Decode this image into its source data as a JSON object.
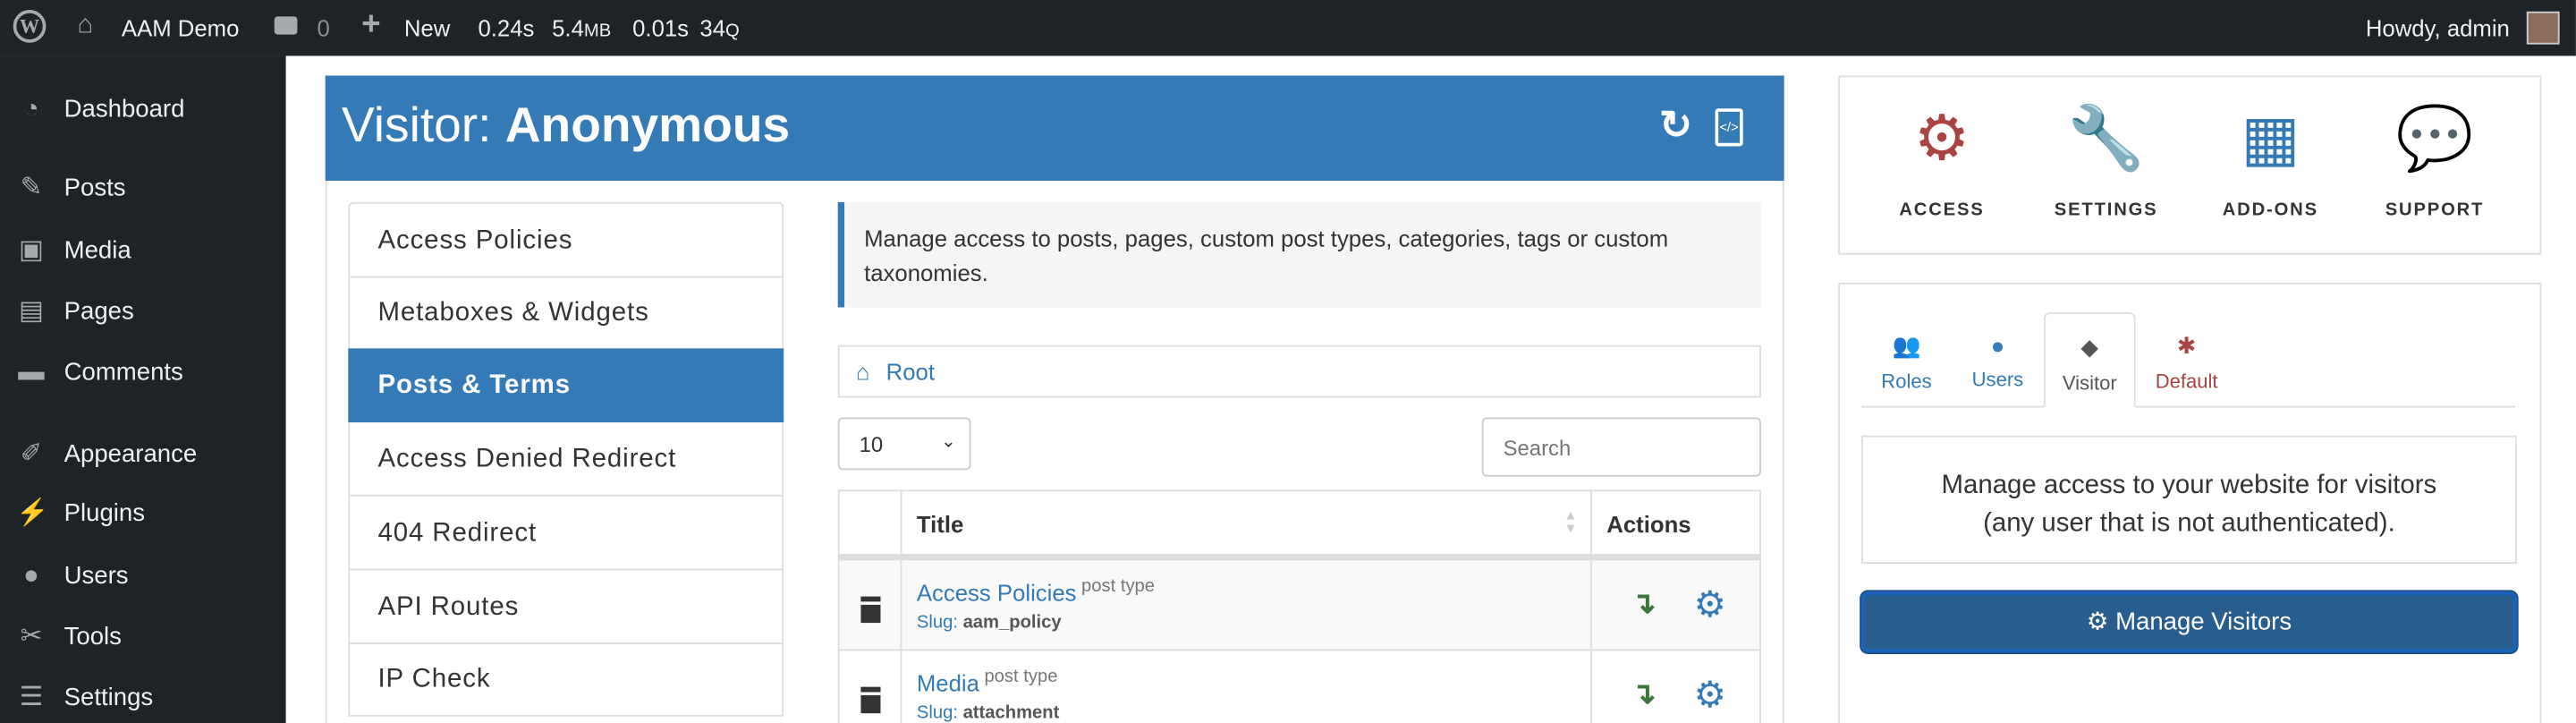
{
  "adminbar": {
    "site": "AAM Demo",
    "comments": "0",
    "new": "New",
    "stats": {
      "time": "0.24s",
      "memory": "5.4",
      "memory_unit": "MB",
      "query_time": "0.01s",
      "queries": "34",
      "queries_unit": "Q"
    },
    "greeting": "Howdy, admin"
  },
  "sidebar": {
    "items": [
      {
        "label": "Dashboard",
        "icon": "dashboard-icon"
      },
      {
        "label": "Posts",
        "icon": "pin-icon"
      },
      {
        "label": "Media",
        "icon": "media-icon"
      },
      {
        "label": "Pages",
        "icon": "pages-icon"
      },
      {
        "label": "Comments",
        "icon": "comment-icon"
      },
      {
        "label": "Appearance",
        "icon": "brush-icon"
      },
      {
        "label": "Plugins",
        "icon": "plug-icon"
      },
      {
        "label": "Users",
        "icon": "user-icon"
      },
      {
        "label": "Tools",
        "icon": "wrench-icon"
      },
      {
        "label": "Settings",
        "icon": "settings-icon"
      }
    ]
  },
  "header": {
    "prefix": "Visitor: ",
    "name": "Anonymous"
  },
  "menu": [
    "Access Policies",
    "Metaboxes & Widgets",
    "Posts & Terms",
    "Access Denied Redirect",
    "404 Redirect",
    "API Routes",
    "IP Check"
  ],
  "info": "Manage access to posts, pages, custom post types, categories, tags or custom taxonomies.",
  "breadcrumb": "Root",
  "page_size": "10",
  "search_placeholder": "Search",
  "table": {
    "headers": {
      "title": "Title",
      "actions": "Actions"
    },
    "rows": [
      {
        "title": "Access Policies",
        "type": "post type",
        "slug_label": "Slug: ",
        "slug": "aam_policy"
      },
      {
        "title": "Media",
        "type": "post type",
        "slug_label": "Slug: ",
        "slug": "attachment"
      }
    ]
  },
  "top_nav": [
    {
      "label": "ACCESS"
    },
    {
      "label": "SETTINGS"
    },
    {
      "label": "ADD-ONS"
    },
    {
      "label": "SUPPORT"
    }
  ],
  "tabs": [
    {
      "label": "Roles"
    },
    {
      "label": "Users"
    },
    {
      "label": "Visitor"
    },
    {
      "label": "Default"
    }
  ],
  "visitor_desc": "Manage access to your website for visitors (any user that is not authenticated).",
  "manage_button": "Manage Visitors",
  "colors": {
    "primary": "#337ab7",
    "admin_bar": "#1d2327",
    "default_red": "#a94442",
    "action_green": "#3c763d"
  }
}
